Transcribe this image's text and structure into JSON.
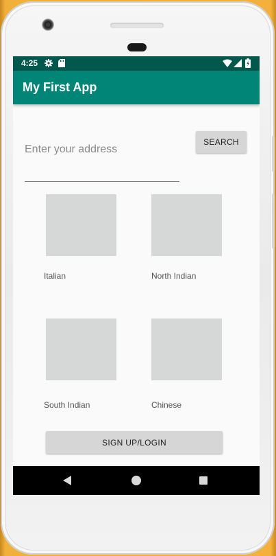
{
  "status_bar": {
    "time": "4:25",
    "icons": [
      "gear-icon",
      "sd-card-icon",
      "wifi-icon",
      "signal-icon",
      "battery-icon"
    ]
  },
  "app_bar": {
    "title": "My First App"
  },
  "search": {
    "placeholder": "Enter your address",
    "button_label": "SEARCH"
  },
  "categories": [
    {
      "label": "Italian"
    },
    {
      "label": "North Indian"
    },
    {
      "label": "South Indian"
    },
    {
      "label": "Chinese"
    }
  ],
  "login_button_label": "SIGN UP/LOGIN",
  "colors": {
    "status_bar": "#00574b",
    "app_bar": "#008577",
    "tile": "#d6d7d7",
    "button": "#d6d6d6"
  }
}
